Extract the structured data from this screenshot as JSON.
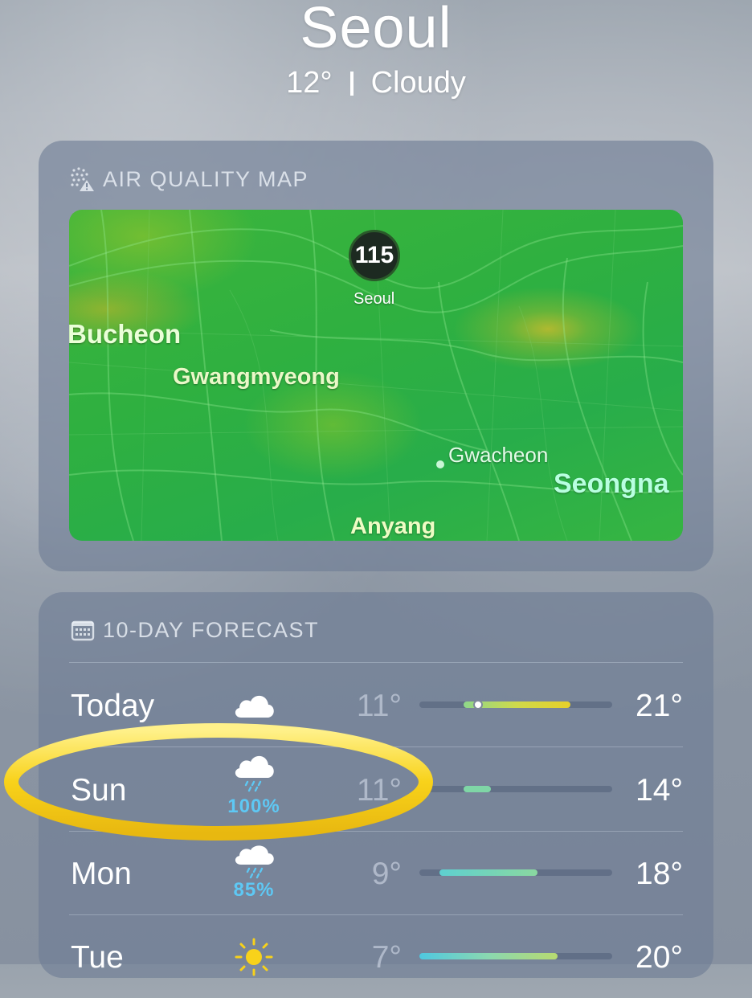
{
  "location": {
    "city": "Seoul",
    "temp": "12°",
    "condition": "Cloudy"
  },
  "air_quality": {
    "header": "AIR QUALITY MAP",
    "aqi_value": "115",
    "aqi_city": "Seoul",
    "places": {
      "bucheon": "Bucheon",
      "gwangmyeong": "Gwangmyeong",
      "gwacheon": "Gwacheon",
      "seongnam": "Seongna",
      "anyang": "Anyang"
    },
    "colors": {
      "map_green": "#2fb040",
      "hotspot_yellow": "#e6be28"
    }
  },
  "forecast": {
    "header": "10-DAY FORECAST",
    "days": [
      {
        "day": "Today",
        "icon": "cloud-icon",
        "precip": "",
        "low": "11°",
        "high": "21°"
      },
      {
        "day": "Sun",
        "icon": "cloud-rain-icon",
        "precip": "100%",
        "low": "11°",
        "high": "14°"
      },
      {
        "day": "Mon",
        "icon": "cloud-rain-icon",
        "precip": "85%",
        "low": "9°",
        "high": "18°"
      },
      {
        "day": "Tue",
        "icon": "sun-icon",
        "precip": "",
        "low": "7°",
        "high": "20°"
      }
    ],
    "colors": {
      "precip": "#5ec8f4",
      "bar_track": "#505f78"
    }
  },
  "annotation": {
    "color": "#f8d21a",
    "target": "Sun"
  }
}
